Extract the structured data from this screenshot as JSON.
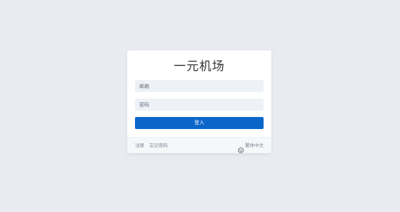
{
  "card": {
    "title": "一元机场"
  },
  "form": {
    "email_placeholder": "邮箱",
    "password_placeholder": "密码",
    "login_label": "登入"
  },
  "footer": {
    "register_label": "注册",
    "forgot_label": "忘记密码",
    "language_label": "繁体中文",
    "language_icon": "globe-smile-icon"
  },
  "colors": {
    "background": "#e9eaf2",
    "primary": "#0b66c9",
    "input_bg": "#eef1f6"
  }
}
